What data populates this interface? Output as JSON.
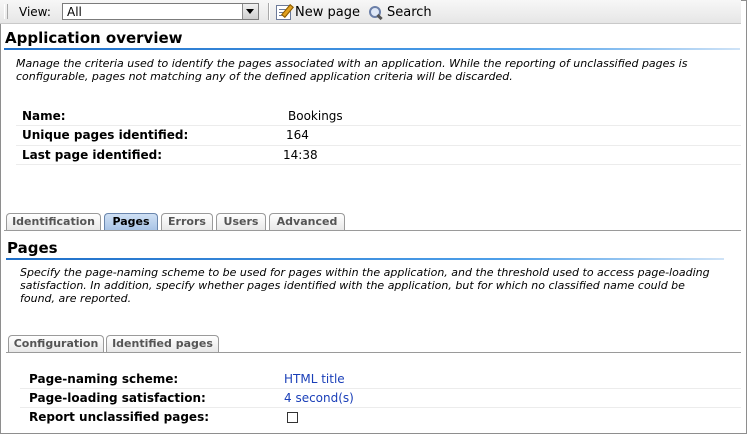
{
  "toolbar": {
    "view_label": "View:",
    "view_select_value": "All",
    "new_page_label": "New page",
    "search_label": "Search"
  },
  "overview": {
    "title": "Application overview",
    "description_line1": "Manage the criteria used to identify the pages associated with an application. While the reporting of unclassified pages is",
    "description_line2": "configurable, pages not matching any of the defined application criteria will be discarded.",
    "fields": [
      {
        "label": "Name:",
        "value": "Bookings"
      },
      {
        "label": "Unique pages identified:",
        "value": "164"
      },
      {
        "label": "Last page identified:",
        "value": "14:38"
      }
    ]
  },
  "main_tabs": [
    {
      "label": "Identification",
      "active": false
    },
    {
      "label": "Pages",
      "active": true
    },
    {
      "label": "Errors",
      "active": false
    },
    {
      "label": "Users",
      "active": false
    },
    {
      "label": "Advanced",
      "active": false
    }
  ],
  "pages": {
    "title": "Pages",
    "description_line1": "Specify the page-naming scheme to be used for pages within the application, and the threshold used to access page-loading",
    "description_line2": "satisfaction. In addition, specify whether pages identified with the application, but for which no classified name could be",
    "description_line3": "found, are reported.",
    "sub_tabs": [
      {
        "label": "Configuration",
        "active": true
      },
      {
        "label": "Identified pages",
        "active": false
      }
    ],
    "config": [
      {
        "label": "Page-naming scheme:",
        "value": "HTML title"
      },
      {
        "label": "Page-loading satisfaction:",
        "value": "4 second(s)"
      },
      {
        "label": "Report unclassified pages:",
        "checked": false
      }
    ]
  },
  "colors": {
    "accent_rule": "#1e6ec8",
    "link": "#1a3fb8",
    "active_tab": "#a9c4e6"
  }
}
